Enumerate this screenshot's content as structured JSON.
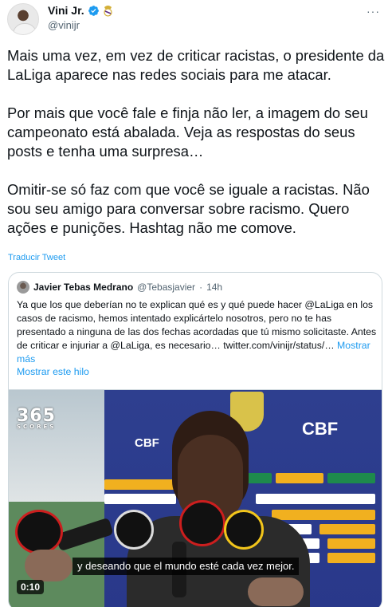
{
  "tweet": {
    "author": {
      "name": "Vini Jr.",
      "handle": "@vinijr",
      "verified": true,
      "affiliate_badge": "real-madrid-badge-icon"
    },
    "more_options_label": "···",
    "paragraphs": [
      "Mais uma vez, em vez de criticar racistas, o presidente da LaLiga aparece nas redes sociais para me atacar.",
      "Por mais que você fale e finja não ler, a imagem do seu campeonato está abalada. Veja as respostas do seus posts e tenha uma surpresa…",
      "Omitir-se só faz com que você se iguale a racistas. Não sou seu amigo para conversar sobre racismo. Quero ações e punições. Hashtag não me comove."
    ],
    "translate_label": "Traducir Tweet"
  },
  "quote": {
    "author_name": "Javier Tebas Medrano",
    "author_handle": "@Tebasjavier",
    "separator": "·",
    "time": "14h",
    "text": "Ya que los que deberían no te explican qué es y qué puede hacer @LaLiga en los casos de racismo, hemos intentado explicártelo nosotros, pero no te has presentado a ninguna de las dos fechas acordadas que tú mismo solicitaste. Antes de criticar e injuriar a @LaLiga, es necesario… twitter.com/vinijr/status/…",
    "show_more_label": "Mostrar más",
    "show_thread_label": "Mostrar este hilo"
  },
  "video": {
    "watermark": "365",
    "watermark_sub": "SCORES",
    "sponsor_cbf": "CBF",
    "caption": "y deseando que el mundo esté cada vez mejor.",
    "duration": "0:10"
  },
  "colors": {
    "link": "#1d9bf0",
    "verified": "#1d9bf0",
    "secondary_text": "#536471",
    "border": "#cfd9de"
  }
}
